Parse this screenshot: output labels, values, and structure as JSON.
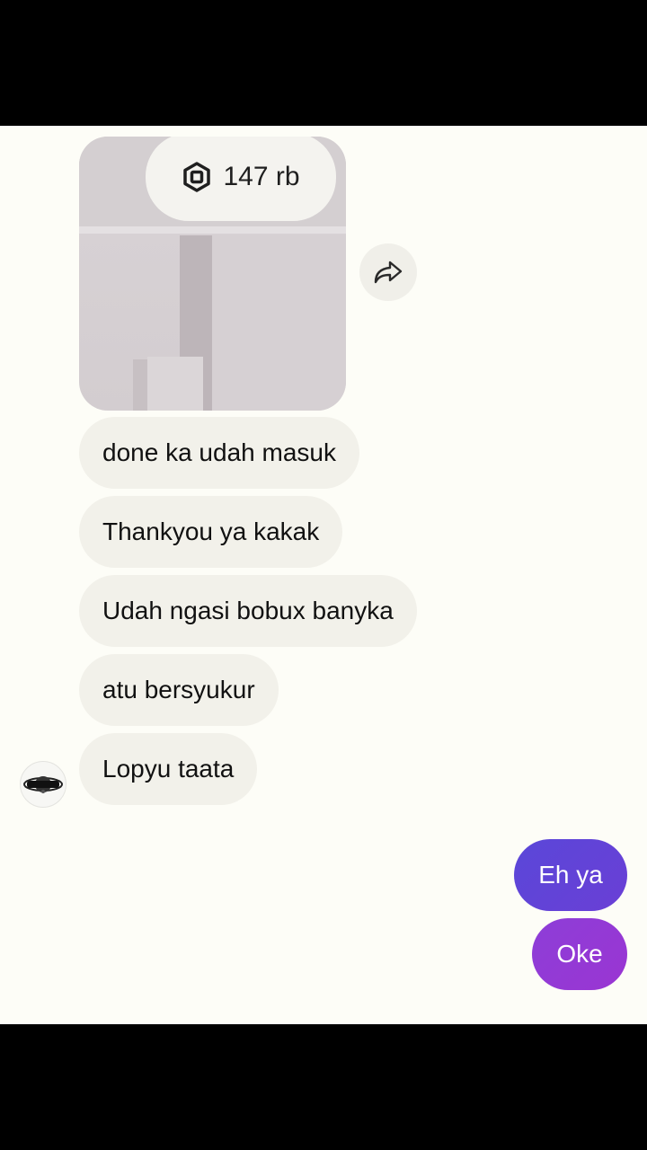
{
  "image_message": {
    "robux_amount": "147 rb",
    "robux_icon": "robux-icon"
  },
  "share_icon": "share-arrow-icon",
  "incoming": [
    {
      "text": "done ka udah masuk"
    },
    {
      "text": "Thankyou ya kakak"
    },
    {
      "text": "Udah ngasi bobux banyka"
    },
    {
      "text": "atu bersyukur"
    },
    {
      "text": "Lopyu taata"
    }
  ],
  "outgoing": [
    {
      "text": "Eh ya"
    },
    {
      "text": "Oke"
    }
  ],
  "colors": {
    "chat_background": "#fdfdf7",
    "incoming_bubble": "#f2f1ea",
    "outgoing_bubble_1": "#5a47d8",
    "outgoing_bubble_2": "#8d3ed8"
  }
}
